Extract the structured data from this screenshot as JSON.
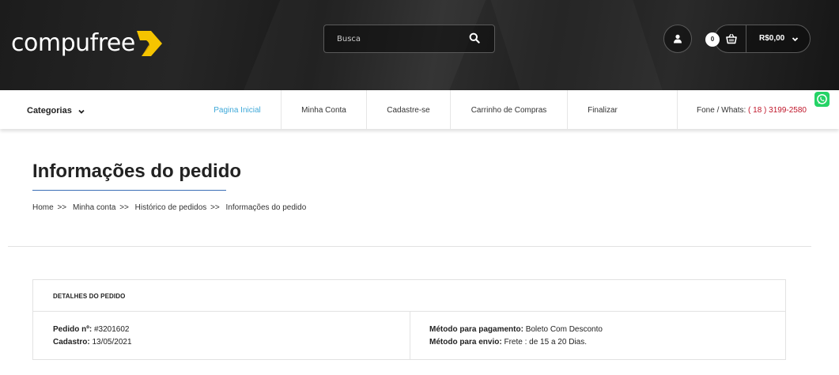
{
  "header": {
    "logo_text": "compufree",
    "search": {
      "placeholder": "Busca"
    },
    "cart": {
      "count": "0",
      "total": "R$0,00"
    }
  },
  "nav": {
    "categories_label": "Categorias",
    "items": [
      {
        "label": "Pagina Inicial",
        "active": true
      },
      {
        "label": "Minha Conta"
      },
      {
        "label": "Cadastre-se"
      },
      {
        "label": "Carrinho de Compras"
      },
      {
        "label": "Finalizar"
      }
    ],
    "phone_label": "Fone / Whats:",
    "phone_number": "( 18 ) 3199-2580"
  },
  "page": {
    "title": "Informações do pedido",
    "breadcrumb": [
      "Home",
      "Minha conta",
      "Histórico de pedidos",
      "Informações do pedido"
    ],
    "breadcrumb_sep": ">>"
  },
  "order": {
    "section_title": "DETALHES DO PEDIDO",
    "number_label": "Pedido nº:",
    "number_value": "#3201602",
    "date_label": "Cadastro:",
    "date_value": "13/05/2021",
    "payment_label": "Método para pagamento:",
    "payment_value": "Boleto Com Desconto",
    "shipping_label": "Método para envio:",
    "shipping_value": "Frete : de 15 a 20 Dias."
  },
  "colors": {
    "accent_link": "#3fa9d9",
    "phone": "#c0172b",
    "logo_mark": "#f5c400",
    "whatsapp": "#25d366"
  },
  "icons": [
    "search-icon",
    "user-icon",
    "basket-icon",
    "chevron-down-icon",
    "whatsapp-icon"
  ]
}
